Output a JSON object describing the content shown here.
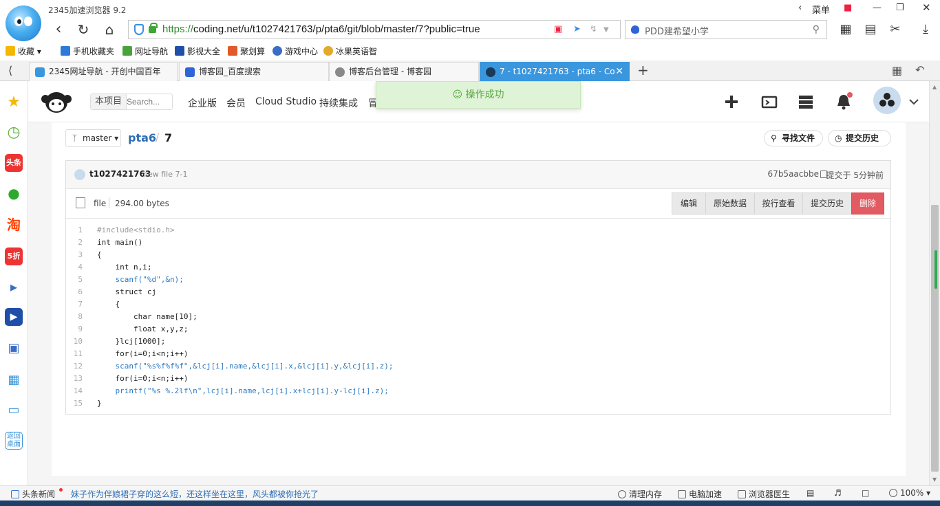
{
  "browser": {
    "app_title": "2345加速浏览器 9.2",
    "url_protocol": "https://",
    "url_rest": "coding.net/u/t1027421763/p/pta6/git/blob/master/7?public=true",
    "search_placeholder": "PDD建希望小学",
    "menu_label": "菜单",
    "colors": {
      "accent": "#3a96dd",
      "secure": "#3fa535"
    }
  },
  "bookmarks": {
    "items": [
      {
        "label": "收藏",
        "icon": "star-icon"
      },
      {
        "label": "手机收藏夹",
        "icon": "phone-icon"
      },
      {
        "label": "网址导航",
        "icon": "nav-icon"
      },
      {
        "label": "影视大全",
        "icon": "video-icon"
      },
      {
        "label": "聚划算",
        "icon": "deal-icon"
      },
      {
        "label": "游戏中心",
        "icon": "game-icon"
      },
      {
        "label": "冰果英语智",
        "icon": "english-icon"
      }
    ]
  },
  "tabs": [
    {
      "label": "2345网址导航 - 开创中国百年"
    },
    {
      "label": "博客园_百度搜索"
    },
    {
      "label": "博客后台管理 - 博客园"
    },
    {
      "label": "7 - t1027421763 - pta6 - Co"
    }
  ],
  "site": {
    "scope_label": "本项目",
    "search_placeholder": "Search...",
    "nav": [
      "企业版",
      "会员",
      "Cloud Studio",
      "持续集成",
      "冒"
    ],
    "toast": "操作成功"
  },
  "repo": {
    "branch": "master",
    "name": "pta6",
    "file": "7",
    "find_file": "寻找文件",
    "commit_history": "提交历史"
  },
  "commit": {
    "user": "t1027421763",
    "message": "new file 7-1",
    "hash": "67b5aacbbe",
    "time": "提交于 5分钟前"
  },
  "file": {
    "type": "file",
    "size": "294.00 bytes",
    "actions": [
      "编辑",
      "原始数据",
      "按行查看",
      "提交历史",
      "删除"
    ]
  },
  "code": [
    {
      "n": "1",
      "text": "#include<stdio.h>"
    },
    {
      "n": "2",
      "text": "int main()"
    },
    {
      "n": "3",
      "text": "{"
    },
    {
      "n": "4",
      "text": "    int n,i;"
    },
    {
      "n": "5",
      "text": "    scanf(\"%d\",&n);"
    },
    {
      "n": "6",
      "text": "    struct cj"
    },
    {
      "n": "7",
      "text": "    {"
    },
    {
      "n": "8",
      "text": "        char name[10];"
    },
    {
      "n": "9",
      "text": "        float x,y,z;"
    },
    {
      "n": "10",
      "text": "    }lcj[1000];"
    },
    {
      "n": "11",
      "text": "    for(i=0;i<n;i++)"
    },
    {
      "n": "12",
      "text": "    scanf(\"%s%f%f%f\",&lcj[i].name,&lcj[i].x,&lcj[i].y,&lcj[i].z);"
    },
    {
      "n": "13",
      "text": "    for(i=0;i<n;i++)"
    },
    {
      "n": "14",
      "text": "    printf(\"%s %.2lf\\n\",lcj[i].name,lcj[i].x+lcj[i].y-lcj[i].z);"
    },
    {
      "n": "15",
      "text": "}"
    }
  ],
  "statusbar": {
    "news_label": "头条新闻",
    "news_text": "妹子作为伴娘裙子穿的这么短，还这样坐在这里，风头都被你抢光了",
    "clean_memory": "清理内存",
    "pc_speedup": "电脑加速",
    "browser_doctor": "浏览器医生",
    "zoom": "100%"
  },
  "sidebar": {
    "back_desktop": "返回桌面"
  }
}
